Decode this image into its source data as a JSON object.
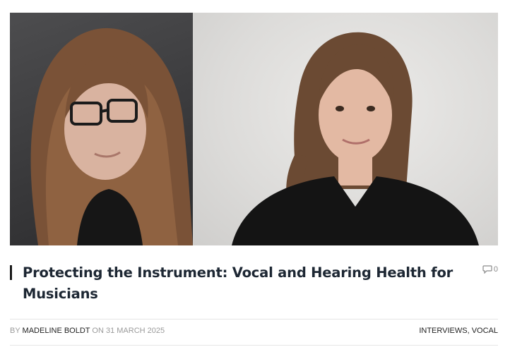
{
  "hero": {
    "left_photo": "portrait of woman with long brown hair and glasses",
    "right_photo": "portrait of smiling woman with hair tied back in dark top"
  },
  "article": {
    "title": "Protecting the Instrument: Vocal and Hearing Health for Musicians",
    "comment_count": "0"
  },
  "meta": {
    "by_label": "BY",
    "author": "MADELINE BOLDT",
    "on_label": "ON",
    "date": "31 MARCH 2025",
    "categories": [
      "INTERVIEWS",
      "VOCAL"
    ],
    "separator": ", "
  },
  "icons": {
    "comments": "comment-bubble-icon"
  }
}
